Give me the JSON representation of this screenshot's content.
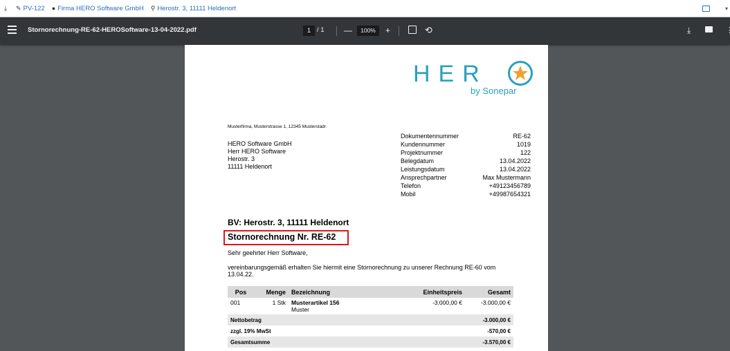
{
  "topbar": {
    "items": [
      {
        "icon": "pencil-icon",
        "label": "PV-122"
      },
      {
        "icon": "user-icon",
        "label": "Firma HERO Software GmbH"
      },
      {
        "icon": "map-marker-icon",
        "label": "Herostr. 3, 11111 Heldenort"
      }
    ]
  },
  "viewer": {
    "filename": "Stornorechnung-RE-62-HEROSoftware-13-04-2022.pdf",
    "page_current": "1",
    "page_total": "/ 1",
    "zoom": "100%",
    "zoom_out": "—",
    "zoom_in": "+"
  },
  "document": {
    "logo_text": "HER",
    "logo_sub": "by Sonepar",
    "sender_line": "Musterfirma, Musterstrasse 1, 12345 Musterstadr",
    "address": [
      "HERO Software GmbH",
      "Herr HERO Software",
      "Herostr. 3",
      "11111 Heldenort"
    ],
    "meta": [
      {
        "label": "Dokumentennummer",
        "value": "RE-62"
      },
      {
        "label": "Kundennummer",
        "value": "1019"
      },
      {
        "label": "Projektnummer",
        "value": "122"
      },
      {
        "label": "Belegdatum",
        "value": "13.04.2022"
      },
      {
        "label": "Leistungsdatum",
        "value": "13.04.2022"
      },
      {
        "label": "Ansprechpartner",
        "value": "Max Mustermann"
      },
      {
        "label": "Telefon",
        "value": "+49123456789"
      },
      {
        "label": "Mobil",
        "value": "+49987654321"
      }
    ],
    "bv": "BV: Herostr. 3, 11111 Heldenort",
    "title": "Stornorechnung Nr. RE-62",
    "greeting": "Sehr geehrter Herr Software,",
    "intro": "vereinbarungsgemäß erhalten Sie hiermit eine Stornorechnung zu unserer Rechnung RE-60 vom 13.04.22.",
    "table": {
      "headers": [
        "Pos",
        "Menge",
        "Bezeichnung",
        "Einheitspreis",
        "Gesamt"
      ],
      "rows": [
        {
          "pos": "001",
          "menge": "1 Stk",
          "name": "Musterartikel 156",
          "sub": "Muster",
          "einzel": "-3.000,00 €",
          "gesamt": "-3.000,00 €"
        }
      ],
      "net_label": "Nettobetrag",
      "net_value": "-3.000,00 €",
      "tax_label": "zzgl. 19% MwSt",
      "tax_value": "-570,00 €",
      "total_label": "Gesamtsumme",
      "total_value": "-3.570,00 €"
    }
  },
  "colors": {
    "accent": "#2aa0c0",
    "highlight": "#e0141a",
    "toolbar": "#323639",
    "background": "#525659"
  }
}
